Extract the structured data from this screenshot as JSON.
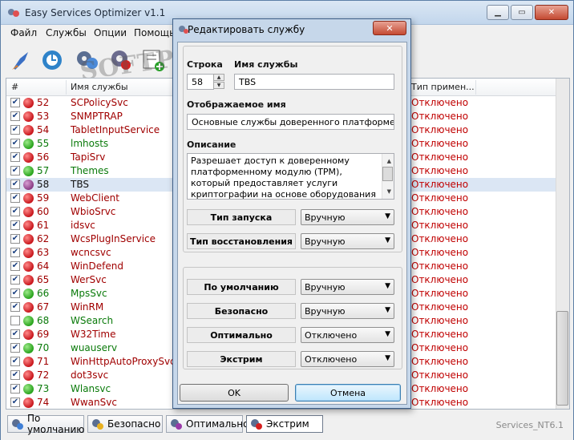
{
  "window": {
    "title": "Easy Services Optimizer v1.1",
    "minimize": "▁",
    "maximize": "▭",
    "close": "✕"
  },
  "menu": [
    "Файл",
    "Службы",
    "Опции",
    "Помощь"
  ],
  "watermark": "SOFTPORTAL",
  "toolbar": {
    "icons": [
      "rocket-icon",
      "refresh-icon",
      "gear-icon",
      "gear-settings-icon",
      "list-add-icon"
    ]
  },
  "list": {
    "headers": {
      "number": "#",
      "name": "Имя службы",
      "startup": "Тип примен..."
    },
    "rows": [
      {
        "checked": true,
        "status": "red",
        "num": "52",
        "name": "SCPolicySvc",
        "color": "red",
        "startup": "Отключено"
      },
      {
        "checked": true,
        "status": "red",
        "num": "53",
        "name": "SNMPTRAP",
        "color": "red",
        "startup": "Отключено"
      },
      {
        "checked": true,
        "status": "red",
        "num": "54",
        "name": "TabletInputService",
        "color": "red",
        "startup": "Отключено"
      },
      {
        "checked": true,
        "status": "green",
        "num": "55",
        "name": "lmhosts",
        "color": "green",
        "startup": "Отключено"
      },
      {
        "checked": true,
        "status": "red",
        "num": "56",
        "name": "TapiSrv",
        "color": "red",
        "startup": "Отключено"
      },
      {
        "checked": true,
        "status": "green",
        "num": "57",
        "name": "Themes",
        "color": "green",
        "startup": "Отключено"
      },
      {
        "checked": true,
        "status": "purple",
        "num": "58",
        "name": "TBS",
        "color": "dark",
        "startup": "Отключено",
        "selected": true
      },
      {
        "checked": true,
        "status": "red",
        "num": "59",
        "name": "WebClient",
        "color": "red",
        "startup": "Отключено"
      },
      {
        "checked": true,
        "status": "red",
        "num": "60",
        "name": "WbioSrvc",
        "color": "red",
        "startup": "Отключено"
      },
      {
        "checked": true,
        "status": "red",
        "num": "61",
        "name": "idsvc",
        "color": "red",
        "startup": "Отключено"
      },
      {
        "checked": true,
        "status": "red",
        "num": "62",
        "name": "WcsPlugInService",
        "color": "red",
        "startup": "Отключено"
      },
      {
        "checked": true,
        "status": "red",
        "num": "63",
        "name": "wcncsvc",
        "color": "red",
        "startup": "Отключено"
      },
      {
        "checked": true,
        "status": "red",
        "num": "64",
        "name": "WinDefend",
        "color": "red",
        "startup": "Отключено"
      },
      {
        "checked": true,
        "status": "red",
        "num": "65",
        "name": "WerSvc",
        "color": "red",
        "startup": "Отключено"
      },
      {
        "checked": true,
        "status": "green",
        "num": "66",
        "name": "MpsSvc",
        "color": "green",
        "startup": "Отключено"
      },
      {
        "checked": true,
        "status": "red",
        "num": "67",
        "name": "WinRM",
        "color": "red",
        "startup": "Отключено"
      },
      {
        "checked": false,
        "status": "green",
        "num": "68",
        "name": "WSearch",
        "color": "green",
        "startup": "Отключено"
      },
      {
        "checked": true,
        "status": "red",
        "num": "69",
        "name": "W32Time",
        "color": "red",
        "startup": "Отключено"
      },
      {
        "checked": true,
        "status": "green",
        "num": "70",
        "name": "wuauserv",
        "color": "green",
        "startup": "Отключено"
      },
      {
        "checked": true,
        "status": "red",
        "num": "71",
        "name": "WinHttpAutoProxySvc",
        "color": "red",
        "startup": "Отключено"
      },
      {
        "checked": true,
        "status": "red",
        "num": "72",
        "name": "dot3svc",
        "color": "red",
        "startup": "Отключено"
      },
      {
        "checked": true,
        "status": "green",
        "num": "73",
        "name": "Wlansvc",
        "color": "green",
        "startup": "Отключено"
      },
      {
        "checked": true,
        "status": "red",
        "num": "74",
        "name": "WwanSvc",
        "color": "red",
        "startup": "Отключено"
      }
    ]
  },
  "profiles": [
    "По умолчанию",
    "Безопасно",
    "Оптимально",
    "Экстрим"
  ],
  "active_profile": 3,
  "status_text": "Services_NT6.1",
  "dialog": {
    "title": "Редактировать службу",
    "close": "✕",
    "row_label": "Строка",
    "row_value": "58",
    "service_name_label": "Имя службы",
    "service_name_value": "TBS",
    "display_name_label": "Отображаемое имя",
    "display_name_value": "Основные службы доверенного платформенного",
    "description_label": "Описание",
    "description_value": "Разрешает доступ к доверенному платформенному модулю (TPM), который предоставляет услуги криптографии на основе оборудования компонентам системы",
    "startup_type_label": "Тип запуска",
    "startup_type_value": "Вручную",
    "recovery_type_label": "Тип восстановления",
    "recovery_type_value": "Вручную",
    "default_label": "По умолчанию",
    "default_value": "Вручную",
    "safe_label": "Безопасно",
    "safe_value": "Вручную",
    "optimal_label": "Оптимально",
    "optimal_value": "Отключено",
    "extreme_label": "Экстрим",
    "extreme_value": "Отключено",
    "ok_label": "OK",
    "cancel_label": "Отмена"
  },
  "colors": {
    "red_text": "#a00000",
    "green_text": "#0a7a0a",
    "startup_text": "#c00000",
    "selection": "#dbe6f4"
  }
}
